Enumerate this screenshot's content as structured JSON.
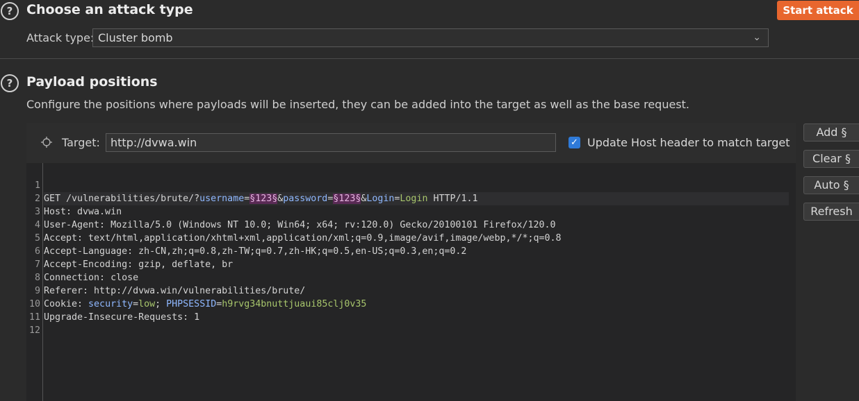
{
  "attack_type": {
    "title": "Choose an attack type",
    "start_label": "Start attack",
    "label": "Attack type:",
    "selected": "Cluster bomb"
  },
  "payload_positions": {
    "title": "Payload positions",
    "description": "Configure the positions where payloads will be inserted, they can be added into the target as well as the base request.",
    "target_label": "Target:",
    "target_value": "http://dvwa.win",
    "update_host_label": "Update Host header to match target",
    "update_host_checked": true
  },
  "side_buttons": {
    "add": "Add §",
    "clear": "Clear §",
    "auto": "Auto §",
    "refresh": "Refresh"
  },
  "request": {
    "line_numbers": [
      "1",
      "2",
      "3",
      "4",
      "5",
      "6",
      "7",
      "8",
      "9",
      "10",
      "11",
      "12"
    ],
    "l1": {
      "a": "GET /vulnerabilities/brute/?",
      "p1": "username",
      "eq1": "=",
      "pay1": "§123§",
      "amp1": "&",
      "p2": "password",
      "eq2": "=",
      "pay2": "§123§",
      "amp2": "&",
      "p3": "Login",
      "eq3": "=",
      "v3": "Login",
      "tail": " HTTP/1.1"
    },
    "l2": "Host: dvwa.win",
    "l3": "User-Agent: Mozilla/5.0 (Windows NT 10.0; Win64; x64; rv:120.0) Gecko/20100101 Firefox/120.0",
    "l4": "Accept: text/html,application/xhtml+xml,application/xml;q=0.9,image/avif,image/webp,*/*;q=0.8",
    "l5": "Accept-Language: zh-CN,zh;q=0.8,zh-TW;q=0.7,zh-HK;q=0.5,en-US;q=0.3,en;q=0.2",
    "l6": "Accept-Encoding: gzip, deflate, br",
    "l7": "Connection: close",
    "l8": "Referer: http://dvwa.win/vulnerabilities/brute/",
    "l9": {
      "a": "Cookie: ",
      "k1": "security",
      "eq1": "=",
      "v1": "low",
      "sep": "; ",
      "k2": "PHPSESSID",
      "eq2": "=",
      "v2": "h9rvg34bnuttjuaui85clj0v35"
    },
    "l10": "Upgrade-Insecure-Requests: 1"
  },
  "colors": {
    "accent": "#e8662e",
    "payload_marker_bg": "#5a2a55",
    "param_name": "#8fb8ff",
    "param_value": "#a8c66c",
    "checkbox": "#2f7ad8"
  }
}
